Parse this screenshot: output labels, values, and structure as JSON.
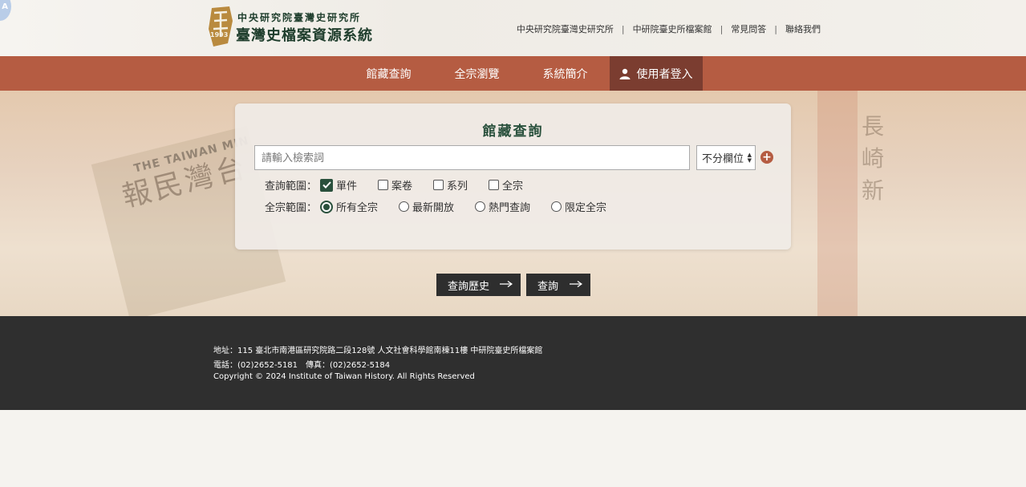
{
  "header": {
    "corner_badge": "A",
    "logo": {
      "year": "1993",
      "institution": "中央研究院臺灣史研究所",
      "system_name": "臺灣史檔案資源系統"
    },
    "top_links": [
      "中央研究院臺灣史研究所",
      "中研院臺史所檔案館",
      "常見問答",
      "聯絡我們"
    ],
    "separator": "|"
  },
  "nav": {
    "items": [
      "館藏查詢",
      "全宗瀏覽",
      "系統簡介"
    ],
    "login": "使用者登入"
  },
  "hero": {
    "deco_text": "報民灣台",
    "deco_en": "THE TAIWAN MIN",
    "deco_vertical": "長崎新"
  },
  "search": {
    "title": "館藏查詢",
    "placeholder": "請輸入檢索詞",
    "field_select": "不分欄位",
    "add_symbol": "+",
    "scope_label": "查詢範圍：",
    "scope_options": [
      {
        "label": "單件",
        "checked": true
      },
      {
        "label": "案卷",
        "checked": false
      },
      {
        "label": "系列",
        "checked": false
      },
      {
        "label": "全宗",
        "checked": false
      }
    ],
    "fonds_label": "全宗範圍：",
    "fonds_options": [
      {
        "label": "所有全宗",
        "checked": true
      },
      {
        "label": "最新開放",
        "checked": false
      },
      {
        "label": "熱門查詢",
        "checked": false
      },
      {
        "label": "限定全宗",
        "checked": false
      }
    ]
  },
  "actions": {
    "history": "查詢歷史",
    "search": "查詢"
  },
  "footer": {
    "address": "地址：115 臺北市南港區研究院路二段128號 人文社會科學館南棟11樓 中研院臺史所檔案館",
    "phone": "電話：(02)2652-5181　傳真：(02)2652-5184",
    "copyright": "Copyright © 2024 Institute of Taiwan History. All Rights Reserved"
  },
  "colors": {
    "nav": "#b55c42",
    "nav_active": "#7b3d30",
    "accent_green": "#29503c",
    "footer": "#2f2f2f"
  }
}
